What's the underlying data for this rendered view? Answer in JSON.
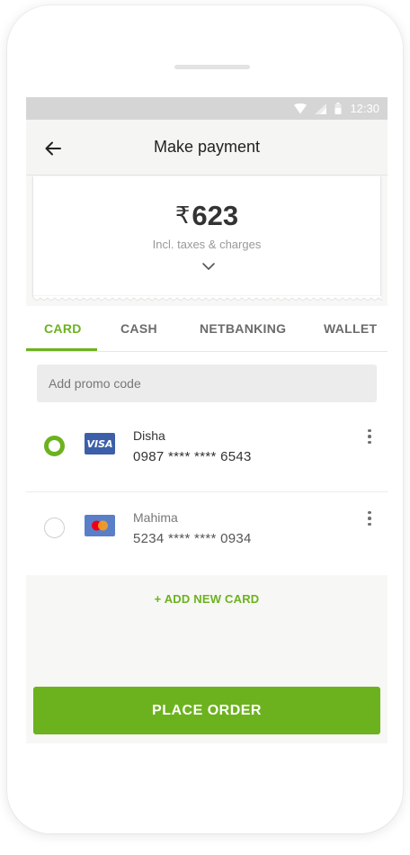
{
  "status_bar": {
    "time": "12:30",
    "icons": [
      "wifi-icon",
      "signal-icon",
      "battery-icon"
    ]
  },
  "app_bar": {
    "back_icon": "arrow-left-icon",
    "title": "Make payment"
  },
  "summary": {
    "currency_symbol": "₹",
    "amount": "623",
    "subtitle": "Incl. taxes & charges",
    "expand_icon": "chevron-down-icon"
  },
  "tabs": [
    {
      "label": "CARD",
      "active": true
    },
    {
      "label": "CASH",
      "active": false
    },
    {
      "label": "NETBANKING",
      "active": false
    },
    {
      "label": "WALLET",
      "active": false
    }
  ],
  "promo": {
    "placeholder": "Add promo code",
    "value": ""
  },
  "cards": [
    {
      "holder": "Disha",
      "number": "0987 **** **** 6543",
      "brand": "VISA",
      "brand_icon": "visa-logo-icon",
      "selected": true,
      "menu_icon": "more-vertical-icon"
    },
    {
      "holder": "Mahima",
      "number": "5234 **** **** 0934",
      "brand": "",
      "brand_icon": "mastercard-logo-icon",
      "selected": false,
      "menu_icon": "more-vertical-icon"
    }
  ],
  "add_card_label": "+ ADD NEW CARD",
  "place_order_label": "PLACE ORDER",
  "colors": {
    "accent": "#6cb21f",
    "status_bar": "#d5d5d5",
    "background": "#f7f7f5",
    "visa_blue": "#3c5fa8",
    "mastercard_red": "#eb001b",
    "mastercard_orange": "#f79e1b"
  }
}
